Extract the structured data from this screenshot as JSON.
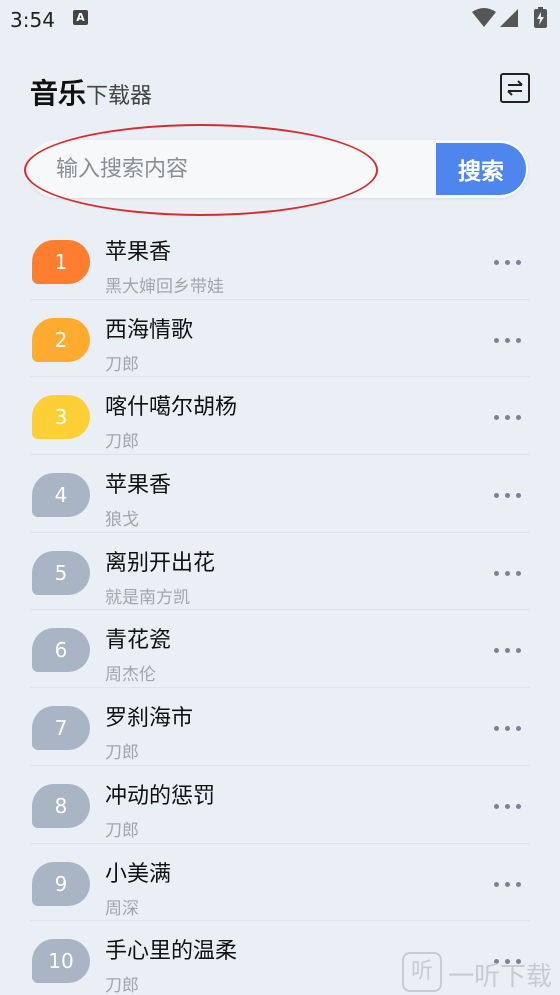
{
  "status_bar": {
    "time": "3:54",
    "notification_glyph": "A",
    "icons": [
      "wifi-icon",
      "signal-icon",
      "battery-icon"
    ]
  },
  "header": {
    "title_main": "音乐",
    "title_sub": "下载器",
    "switch_icon": "swap-icon"
  },
  "search": {
    "placeholder": "输入搜索内容",
    "value": "",
    "button_label": "搜索",
    "button_color": "#4f86ee"
  },
  "songs": [
    {
      "rank": "1",
      "title": "苹果香",
      "artist": "黑大婶回乡带娃",
      "badge_color": "#ff7d2e"
    },
    {
      "rank": "2",
      "title": "西海情歌",
      "artist": "刀郎",
      "badge_color": "#ffab30"
    },
    {
      "rank": "3",
      "title": "喀什噶尔胡杨",
      "artist": "刀郎",
      "badge_color": "#ffcf36"
    },
    {
      "rank": "4",
      "title": "苹果香",
      "artist": "狼戈",
      "badge_color": "#a9b4c4"
    },
    {
      "rank": "5",
      "title": "离别开出花",
      "artist": "就是南方凯",
      "badge_color": "#a9b4c4"
    },
    {
      "rank": "6",
      "title": "青花瓷",
      "artist": "周杰伦",
      "badge_color": "#a9b4c4"
    },
    {
      "rank": "7",
      "title": "罗刹海市",
      "artist": "刀郎",
      "badge_color": "#a9b4c4"
    },
    {
      "rank": "8",
      "title": "冲动的惩罚",
      "artist": "刀郎",
      "badge_color": "#a9b4c4"
    },
    {
      "rank": "9",
      "title": "小美满",
      "artist": "周深",
      "badge_color": "#a9b4c4"
    },
    {
      "rank": "10",
      "title": "手心里的温柔",
      "artist": "刀郎",
      "badge_color": "#a9b4c4"
    }
  ],
  "watermark": {
    "icon_glyph": "听",
    "text": "一听下载"
  }
}
